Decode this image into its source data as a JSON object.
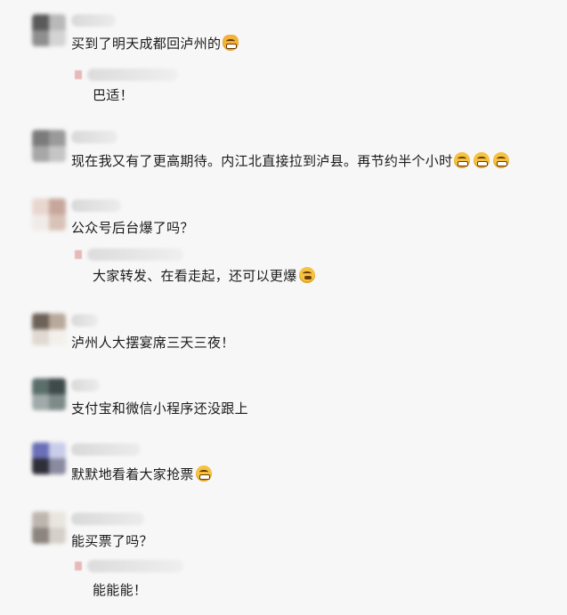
{
  "comments": [
    {
      "text": "买到了明天成都回泸州的",
      "emoji": [
        "cat-grin-emoji"
      ],
      "avatar_colors": [
        "#5a5a5a",
        "#b9b9b9",
        "#8f8f8f",
        "#d4d4d4"
      ],
      "reply": {
        "text": "巴适！"
      }
    },
    {
      "text": "现在我又有了更高期待。内江北直接拉到泸县。再节约半个小时",
      "emoji": [
        "grin-emoji",
        "grin-emoji",
        "grin-emoji"
      ],
      "avatar_colors": [
        "#7b7b7b",
        "#9a9a9a",
        "#a7a7a7",
        "#c5c5c5"
      ]
    },
    {
      "text": "公众号后台爆了吗？",
      "emoji": [],
      "avatar_colors": [
        "#e9d6cf",
        "#c7a79c",
        "#f0ebe8",
        "#d9c2b8"
      ],
      "reply": {
        "text": "大家转发、在看走起，还可以更爆",
        "emoji": [
          "thinking-emoji"
        ]
      }
    },
    {
      "text": "泸州人大摆宴席三天三夜！",
      "emoji": [],
      "avatar_colors": [
        "#6d6258",
        "#b8a99c",
        "#e1d9d1",
        "#f3efea"
      ]
    },
    {
      "text": "支付宝和微信小程序还没跟上",
      "emoji": [],
      "avatar_colors": [
        "#5b6e6a",
        "#3f4a4a",
        "#a0aaa8",
        "#7c8b88"
      ]
    },
    {
      "text": "默默地看着大家抢票",
      "emoji": [
        "grimace-emoji"
      ],
      "avatar_colors": [
        "#6a6fb8",
        "#c9cdea",
        "#2f2f3a",
        "#8a8aa0"
      ]
    },
    {
      "text": "能买票了吗？",
      "emoji": [],
      "avatar_colors": [
        "#bdb6ae",
        "#e9e5df",
        "#8c857f",
        "#d6d0c9"
      ],
      "reply": {
        "text": "能能能！"
      }
    }
  ]
}
